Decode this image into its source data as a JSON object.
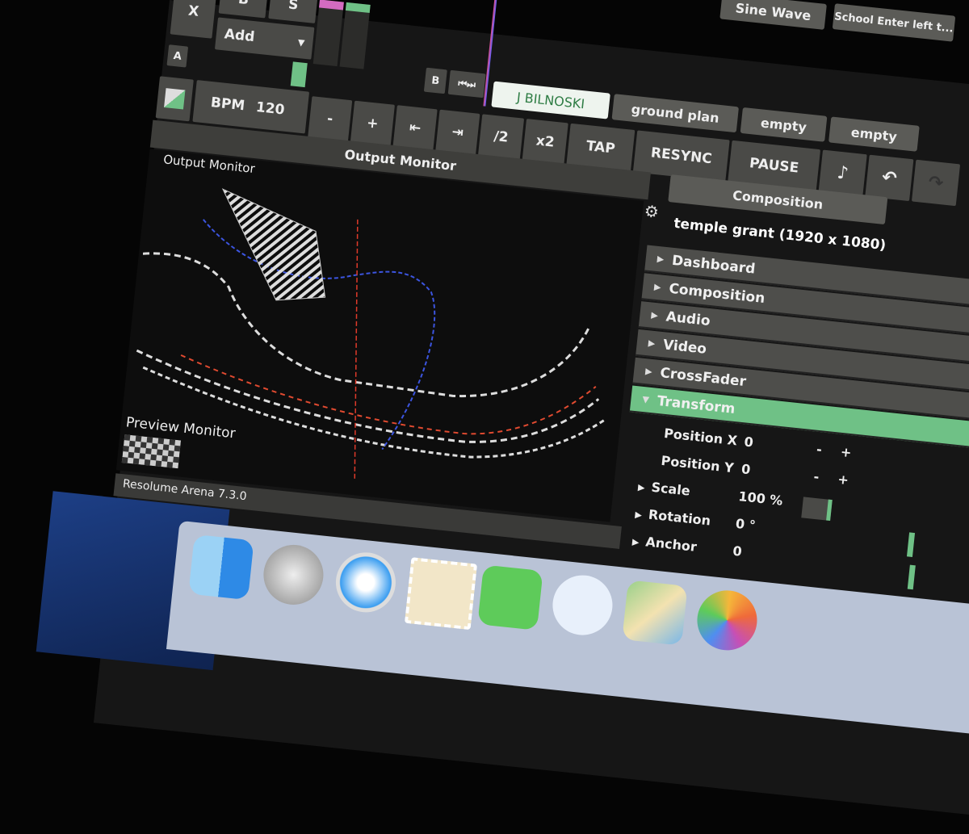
{
  "top_row": {
    "close_label": "X",
    "b_label": "B",
    "s_label": "S",
    "add_label": "Add",
    "a_label": "A",
    "deck_tabs_top": [
      "Sine Wave",
      "School Enter left t..."
    ]
  },
  "transport": {
    "bpm_label": "BPM",
    "bpm_value": "120",
    "buttons": [
      "-",
      "+",
      "⇤",
      "⇥",
      "/2",
      "x2",
      "TAP",
      "RESYNC",
      "PAUSE"
    ],
    "b_label": "B",
    "skip_icons": "⏮⏭"
  },
  "deck_tabs": [
    {
      "label": "J BILNOSKI",
      "active": true
    },
    {
      "label": "ground plan",
      "active": false
    },
    {
      "label": "empty",
      "active": false
    },
    {
      "label": "empty",
      "active": false
    }
  ],
  "monitor": {
    "tab_label": "Output Monitor",
    "inner_label": "Output Monitor",
    "preview_label": "Preview Monitor"
  },
  "app_status": "Resolume Arena 7.3.0",
  "composition": {
    "tab_label": "Composition",
    "name": "temple grant (1920 x 1080)",
    "sections": [
      {
        "label": "Dashboard",
        "expanded": false
      },
      {
        "label": "Composition",
        "expanded": false
      },
      {
        "label": "Audio",
        "expanded": false
      },
      {
        "label": "Video",
        "expanded": false
      },
      {
        "label": "CrossFader",
        "expanded": false
      },
      {
        "label": "Transform",
        "expanded": true
      }
    ],
    "transform": {
      "position_x": {
        "label": "Position X",
        "value": "0"
      },
      "position_y": {
        "label": "Position Y",
        "value": "0"
      },
      "scale": {
        "label": "Scale",
        "value": "100 %"
      },
      "rotation": {
        "label": "Rotation",
        "value": "0 °"
      },
      "anchor": {
        "label": "Anchor",
        "value": "0"
      }
    }
  },
  "dock": [
    "finder-icon",
    "launchpad-icon",
    "safari-icon",
    "mail-icon",
    "facetime-icon",
    "messages-icon",
    "maps-icon",
    "photos-icon"
  ],
  "colors": {
    "accent_green": "#6fc186",
    "panel": "#4e4e4b",
    "background": "#161616"
  }
}
